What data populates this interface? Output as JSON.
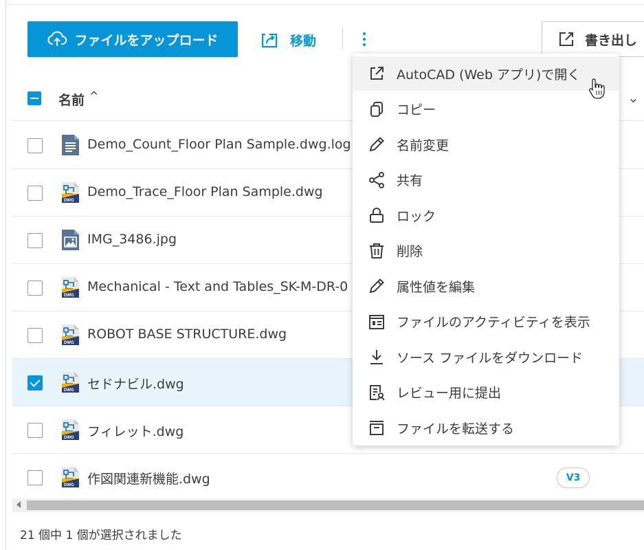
{
  "toolbar": {
    "upload_label": "ファイルをアップロード",
    "move_label": "移動",
    "export_label": "書き出し"
  },
  "table": {
    "name_header": "名前",
    "sort_indicator": "^",
    "rows": [
      {
        "name": "Demo_Count_Floor Plan Sample.dwg.log",
        "icon": "log-file-icon",
        "checked": false
      },
      {
        "name": "Demo_Trace_Floor Plan Sample.dwg",
        "icon": "dwg-file-icon",
        "checked": false
      },
      {
        "name": "IMG_3486.jpg",
        "icon": "image-file-icon",
        "checked": false
      },
      {
        "name": "Mechanical - Text and Tables_SK-M-DR-0",
        "icon": "dwg-file-icon",
        "checked": false
      },
      {
        "name": "ROBOT BASE STRUCTURE.dwg",
        "icon": "dwg-file-icon",
        "checked": false
      },
      {
        "name": "セドナビル.dwg",
        "icon": "dwg-file-icon",
        "checked": true
      },
      {
        "name": "フィレット.dwg",
        "icon": "dwg-file-icon",
        "checked": false
      },
      {
        "name": "作図関連新機能.dwg",
        "icon": "dwg-file-icon",
        "checked": false,
        "version": "V3"
      }
    ]
  },
  "status_text": "21 個中 1 個が選択されました",
  "menu": {
    "items": [
      {
        "label": "AutoCAD (Web アプリ)で開く",
        "icon": "open-external-icon"
      },
      {
        "label": "コピー",
        "icon": "copy-icon"
      },
      {
        "label": "名前変更",
        "icon": "pencil-icon"
      },
      {
        "label": "共有",
        "icon": "share-icon"
      },
      {
        "label": "ロック",
        "icon": "lock-icon"
      },
      {
        "label": "削除",
        "icon": "trash-icon"
      },
      {
        "label": "属性値を編集",
        "icon": "edit-pencil-icon"
      },
      {
        "label": "ファイルのアクティビティを表示",
        "icon": "activity-icon"
      },
      {
        "label": "ソース ファイルをダウンロード",
        "icon": "download-icon"
      },
      {
        "label": "レビュー用に提出",
        "icon": "review-icon"
      },
      {
        "label": "ファイルを転送する",
        "icon": "transfer-icon"
      }
    ]
  },
  "colors": {
    "accent": "#0696d7",
    "selected_row": "#e8f4fb",
    "text": "#3c3c3c"
  }
}
